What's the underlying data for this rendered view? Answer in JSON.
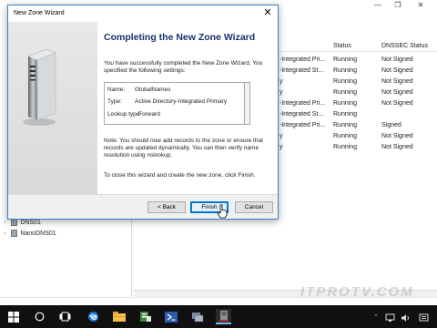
{
  "background_window": {
    "columns": {
      "type": "",
      "status": "Status",
      "dnssec": "DNSSEC Status"
    },
    "rows": [
      {
        "type": "-Integrated Pri...",
        "status": "Running",
        "dnssec": "Not Signed"
      },
      {
        "type": "-Integrated St...",
        "status": "Running",
        "dnssec": "Not Signed"
      },
      {
        "type": "y",
        "status": "Running",
        "dnssec": "Not Signed"
      },
      {
        "type": "y",
        "status": "Running",
        "dnssec": "Not Signed"
      },
      {
        "type": "-Integrated Pri...",
        "status": "Running",
        "dnssec": "Not Signed"
      },
      {
        "type": "-Integrated St...",
        "status": "Running",
        "dnssec": ""
      },
      {
        "type": "-Integrated Pri...",
        "status": "Running",
        "dnssec": "Signed"
      },
      {
        "type": "y",
        "status": "Running",
        "dnssec": "Not Signed"
      },
      {
        "type": "y",
        "status": "Running",
        "dnssec": "Not Signed"
      }
    ],
    "tree": [
      {
        "label": "DNS01"
      },
      {
        "label": "NanoDNS01"
      }
    ]
  },
  "wizard": {
    "title": "New Zone Wizard",
    "heading": "Completing the New Zone Wizard",
    "intro": "You have successfully completed the New Zone Wizard. You specified the following settings:",
    "settings": [
      {
        "key": "Name:",
        "value": "GlobalNames"
      },
      {
        "key": "Type:",
        "value": "Active Directory-Integrated Primary"
      },
      {
        "key": "Lookup type:",
        "value": "Forward"
      }
    ],
    "note": "Note: You should now add records to the zone or ensure that records are updated dynamically. You can then verify name resolution using nslookup.",
    "finish_text": "To close this wizard and create the new zone, click Finish.",
    "buttons": {
      "back": "< Back",
      "finish": "Finish",
      "cancel": "Cancel"
    }
  },
  "watermark": "ITPROTV.COM",
  "taskbar": {
    "tray_time": ""
  }
}
